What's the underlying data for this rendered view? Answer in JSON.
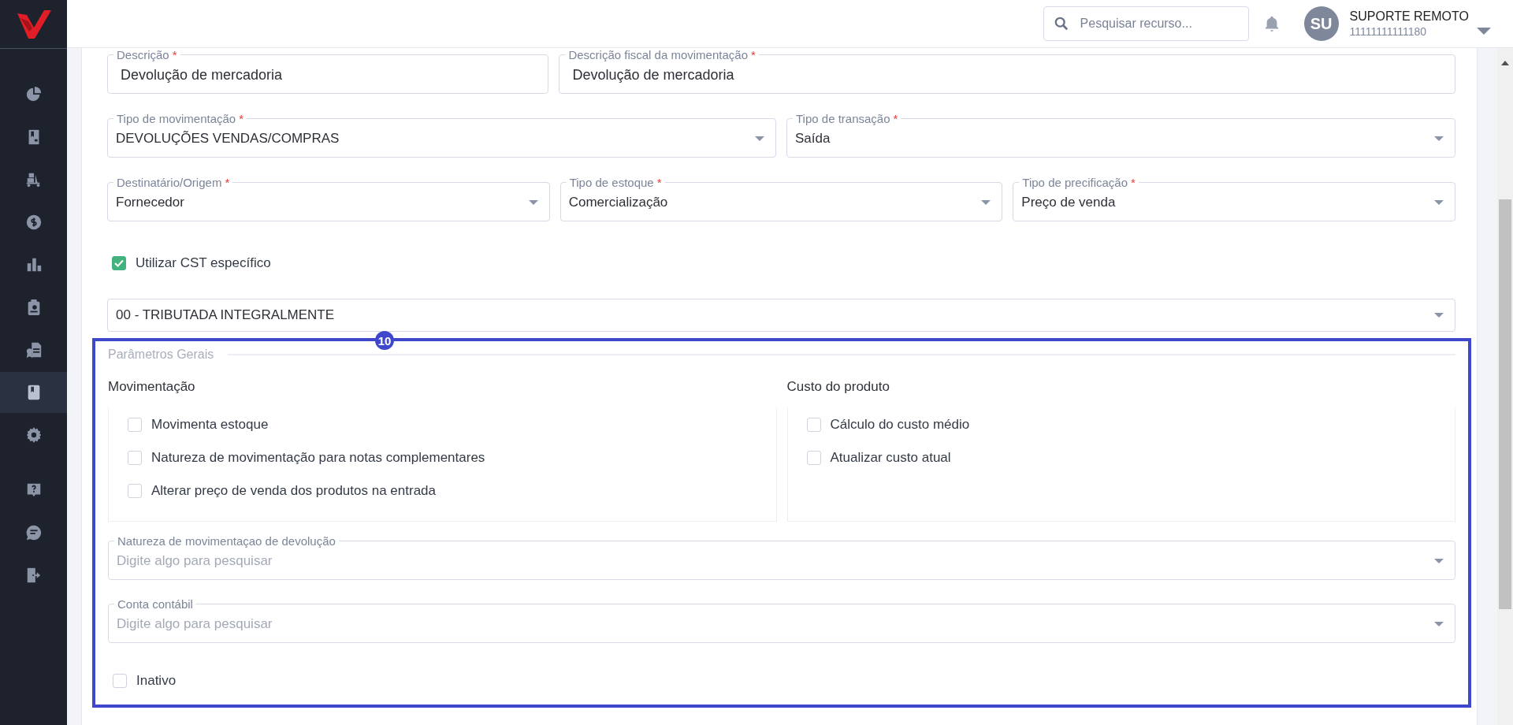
{
  "sidebar": {
    "items": [
      {
        "selected": false
      },
      {
        "selected": false
      },
      {
        "selected": false
      },
      {
        "selected": false
      },
      {
        "selected": false
      },
      {
        "selected": false
      },
      {
        "selected": false
      },
      {
        "selected": true
      },
      {
        "selected": false
      },
      {
        "selected": false
      },
      {
        "selected": false
      },
      {
        "selected": false
      }
    ]
  },
  "header": {
    "search": {
      "placeholder": "Pesquisar recurso..."
    },
    "avatar": "SU",
    "user_name": "SUPORTE REMOTO",
    "user_id": "11111111111180"
  },
  "form": {
    "rows": [
      [
        {
          "kind": "input",
          "label": "Descrição",
          "required_mark": "*",
          "value": "Devolução de mercadoria"
        },
        {
          "kind": "input",
          "label": "Descrição fiscal da movimentação",
          "required_mark": "*",
          "value": "Devolução de mercadoria"
        }
      ],
      [
        {
          "kind": "select",
          "label": "Tipo de movimentação",
          "required_mark": "*",
          "value": "DEVOLUÇÕES VENDAS/COMPRAS"
        },
        {
          "kind": "select",
          "label": "Tipo de transação",
          "required_mark": "*",
          "value": "Saída"
        }
      ],
      [
        {
          "kind": "select",
          "label": "Destinatário/Origem",
          "required_mark": "*",
          "value": "Fornecedor"
        },
        {
          "kind": "select",
          "label": "Tipo de estoque",
          "required_mark": "*",
          "value": "Comercialização"
        },
        {
          "kind": "select",
          "label": "Tipo de precificação",
          "required_mark": "*",
          "value": "Preço de venda"
        }
      ]
    ],
    "cst_checkbox": {
      "label": "Utilizar CST específico",
      "checked": true
    },
    "cst_select": {
      "value": "00 - TRIBUTADA INTEGRALMENTE"
    }
  },
  "section": {
    "badge": "10",
    "title": "Parâmetros Gerais",
    "groups": [
      {
        "title": "Movimentação",
        "options": [
          {
            "label": "Movimenta estoque",
            "checked": false
          },
          {
            "label": "Natureza de movimentação para notas complementares",
            "checked": false
          },
          {
            "label": "Alterar preço de venda dos produtos na entrada",
            "checked": false
          }
        ]
      },
      {
        "title": "Custo do produto",
        "options": [
          {
            "label": "Cálculo do custo médio",
            "checked": false
          },
          {
            "label": "Atualizar custo atual",
            "checked": false
          }
        ]
      }
    ],
    "lookups": [
      {
        "label": "Natureza de movimentaçao de devolução",
        "placeholder": "Digite algo para pesquisar"
      },
      {
        "label": "Conta contábil",
        "placeholder": "Digite algo para pesquisar"
      }
    ],
    "inactive": {
      "label": "Inativo",
      "checked": false
    }
  }
}
